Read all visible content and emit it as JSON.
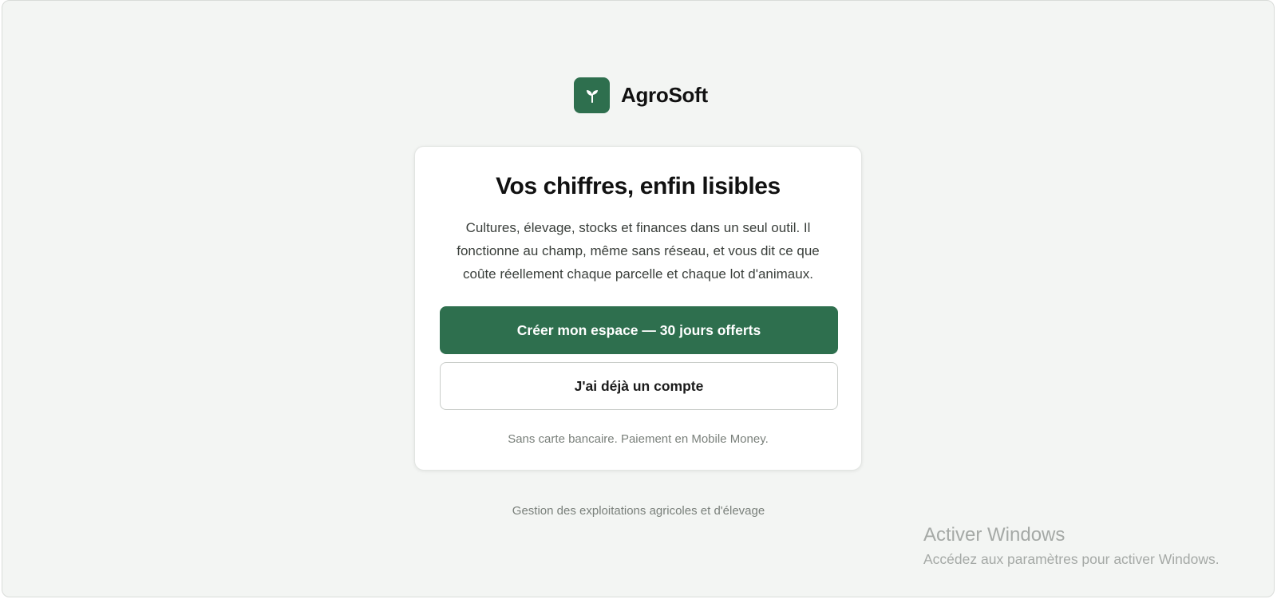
{
  "brand": {
    "name": "AgroSoft",
    "logo_icon": "sprout-icon",
    "accent_color": "#2e6f4e"
  },
  "card": {
    "title": "Vos chiffres, enfin lisibles",
    "description": "Cultures, élevage, stocks et finances dans un seul outil. Il fonctionne au champ, même sans réseau, et vous dit ce que coûte réellement chaque parcelle et chaque lot d'animaux.",
    "primary_button": "Créer mon espace — 30 jours offerts",
    "secondary_button": "J'ai déjà un compte",
    "note": "Sans carte bancaire. Paiement en Mobile Money."
  },
  "footer": {
    "tagline": "Gestion des exploitations agricoles et d'élevage"
  },
  "windows_watermark": {
    "title": "Activer Windows",
    "subtitle": "Accédez aux paramètres pour activer Windows."
  }
}
